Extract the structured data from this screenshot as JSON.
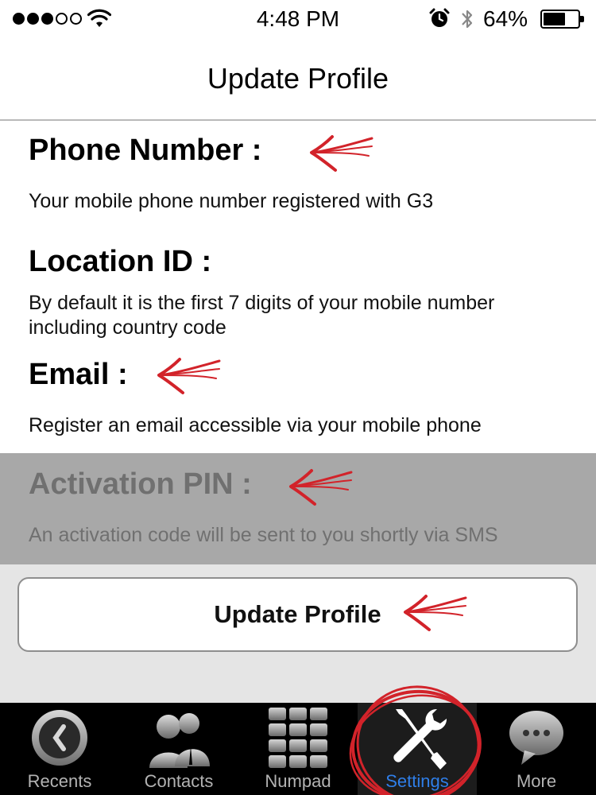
{
  "status_bar": {
    "time": "4:48 PM",
    "battery_percent": "64%",
    "battery_level": 0.64,
    "signal_bars": 3,
    "signal_total": 5,
    "icons": [
      "wifi-icon",
      "alarm-icon",
      "bluetooth-icon",
      "battery-icon"
    ]
  },
  "nav": {
    "title": "Update Profile"
  },
  "sections": {
    "phone": {
      "title": "Phone Number :",
      "description": "Your mobile phone number registered with G3"
    },
    "location": {
      "title": "Location ID :",
      "description": "By default it is the first 7 digits of your mobile number including country code"
    },
    "email": {
      "title": "Email :",
      "description": "Register an email accessible via your mobile phone"
    },
    "pin": {
      "title": "Activation PIN :",
      "description": "An activation code will be sent to you shortly via SMS"
    }
  },
  "update_button": {
    "label": "Update Profile"
  },
  "tabbar": {
    "tabs": [
      {
        "label": "Recents",
        "icon": "clock-icon"
      },
      {
        "label": "Contacts",
        "icon": "contacts-icon"
      },
      {
        "label": "Numpad",
        "icon": "numpad-icon"
      },
      {
        "label": "Settings",
        "icon": "settings-tools-icon",
        "active": true
      },
      {
        "label": "More",
        "icon": "more-chat-icon"
      }
    ]
  },
  "colors": {
    "annotation_red": "#d2232a",
    "active_tab": "#2f7ee8",
    "disabled_band": "#a8a8a8",
    "button_area": "#e5e5e5"
  }
}
